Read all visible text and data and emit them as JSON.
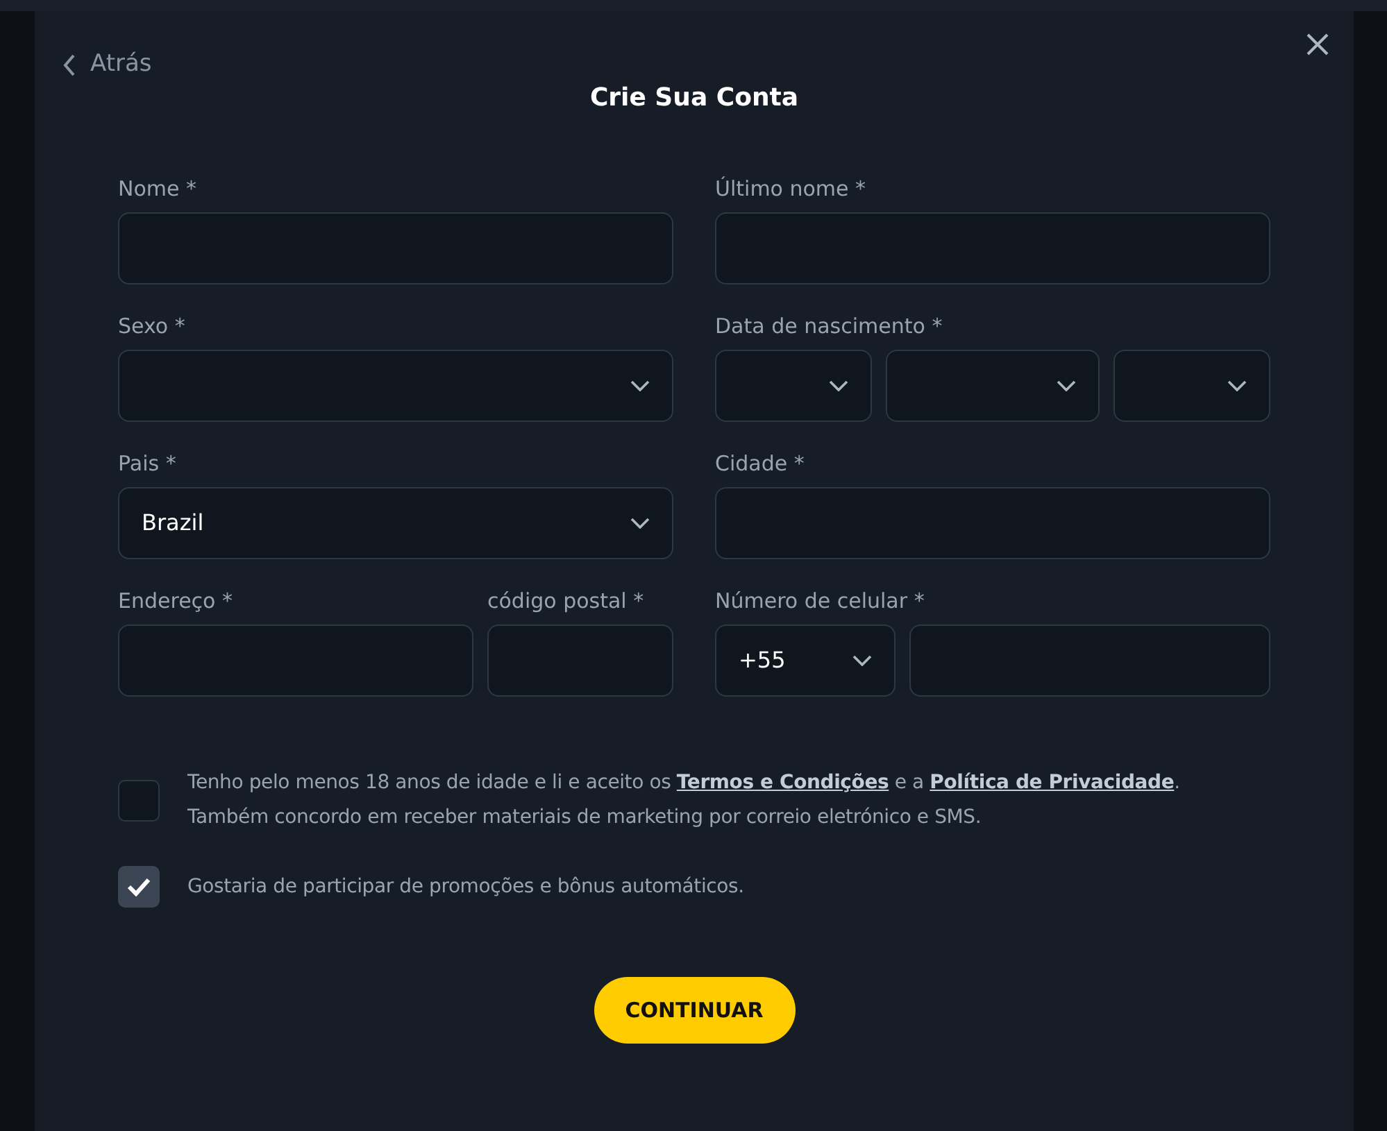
{
  "back_link": {
    "label": "Atrás"
  },
  "title": "Crie Sua Conta",
  "fields": [
    {
      "kind": "text",
      "label": "Nome *"
    },
    {
      "kind": "text",
      "label": "Último nome *"
    },
    {
      "kind": "select",
      "label": "Sexo *"
    },
    {
      "kind": "date",
      "label": "Data de nascimento *"
    },
    {
      "kind": "select",
      "label": "Pais *",
      "value": "Brazil"
    },
    {
      "kind": "text",
      "label": "Cidade *"
    },
    {
      "kind": "address",
      "label": "Endereço *",
      "postal_label": "código postal *"
    },
    {
      "kind": "phone",
      "label": "Número de celular *",
      "prefix": "+55"
    }
  ],
  "agreements": [
    {
      "checked": false,
      "parts": [
        {
          "kind": "text",
          "text": "Tenho pelo menos 18 anos de idade e li e aceito os "
        },
        {
          "kind": "link",
          "text": "Termos e Condições"
        },
        {
          "kind": "text",
          "text": " e a "
        },
        {
          "kind": "link",
          "text": "Política de Privacidade"
        },
        {
          "kind": "text",
          "text": ". Também concordo em receber materiais de marketing por correio eletrónico e SMS."
        }
      ]
    },
    {
      "checked": true,
      "parts": [
        {
          "kind": "text",
          "text": "Gostaria de participar de promoções e bônus automáticos."
        }
      ]
    }
  ],
  "submit": {
    "label": "CONTINUAR"
  }
}
